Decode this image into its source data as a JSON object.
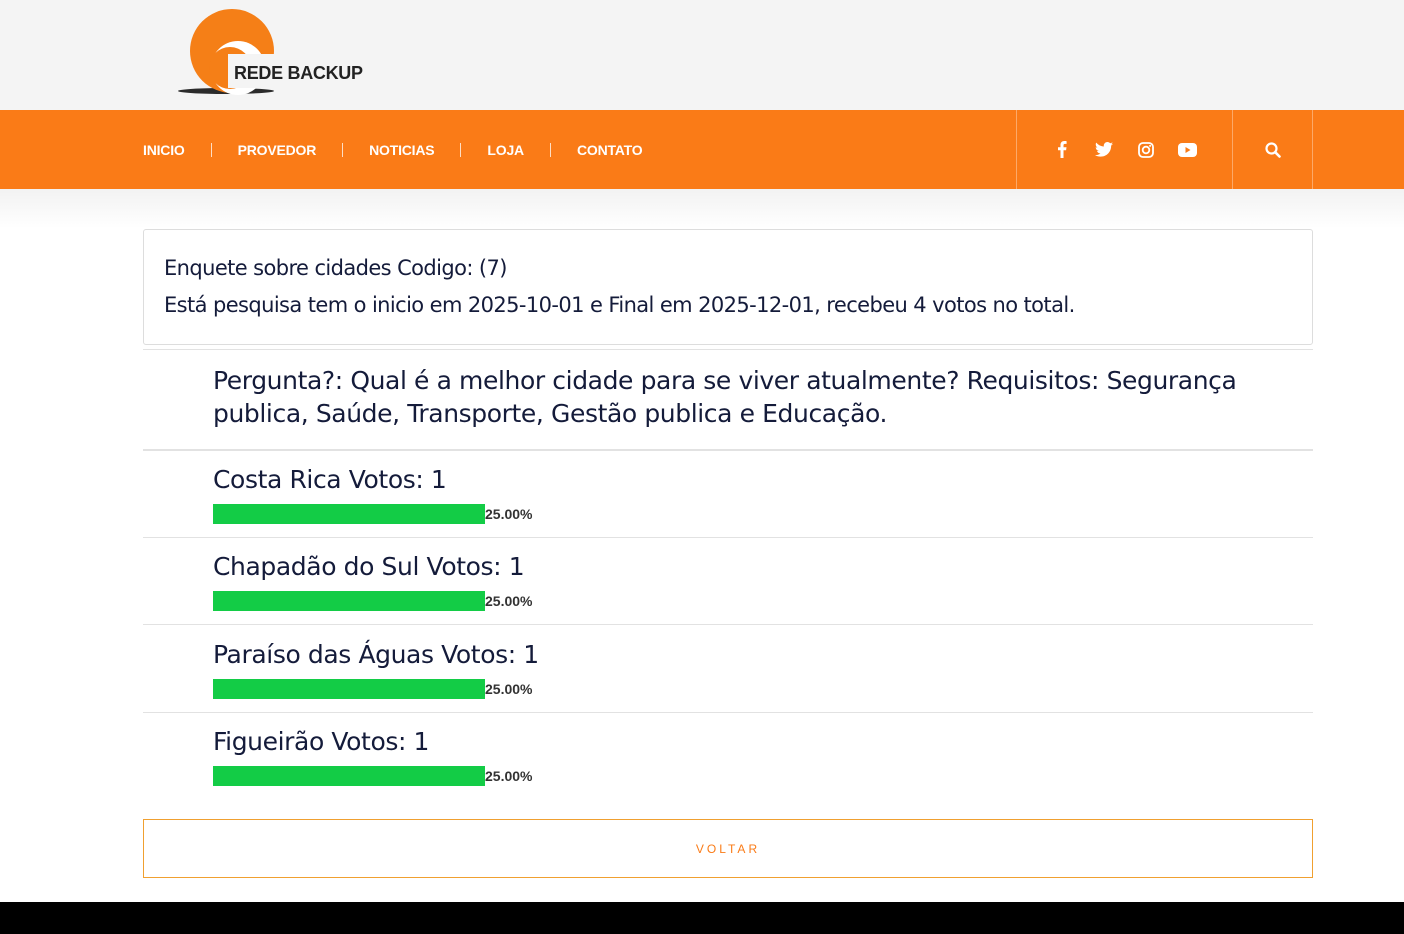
{
  "header": {
    "logo_text": "REDE BACKUP"
  },
  "nav": {
    "items": [
      {
        "label": "INICIO"
      },
      {
        "label": "PROVEDOR"
      },
      {
        "label": "NOTICIAS"
      },
      {
        "label": "LOJA"
      },
      {
        "label": "CONTATO"
      }
    ],
    "social_icons": [
      "facebook-icon",
      "twitter-icon",
      "instagram-icon",
      "youtube-icon"
    ],
    "search_icon": "search-icon"
  },
  "poll": {
    "title": "Enquete sobre cidades Codigo: (7)",
    "summary": "Está pesquisa tem o inicio em 2025-10-01 e Final em 2025-12-01, recebeu 4 votos no total.",
    "question": "Pergunta?: Qual é a melhor cidade para se viver atualmente? Requisitos: Segurança publica, Saúde, Transporte, Gestão publica e Educação.",
    "options": [
      {
        "label": "Costa Rica Votos: 1",
        "percent_text": "25.00%",
        "percent": 25
      },
      {
        "label": "Chapadão do Sul Votos: 1",
        "percent_text": "25.00%",
        "percent": 25
      },
      {
        "label": "Paraíso das Águas Votos: 1",
        "percent_text": "25.00%",
        "percent": 25
      },
      {
        "label": "Figueirão Votos: 1",
        "percent_text": "25.00%",
        "percent": 25
      }
    ],
    "back_label": "VOLTAR"
  },
  "colors": {
    "brand_orange": "#fa7b17",
    "bar_green": "#13cc46",
    "text_navy": "#141b3a",
    "footer_black": "#000000"
  }
}
